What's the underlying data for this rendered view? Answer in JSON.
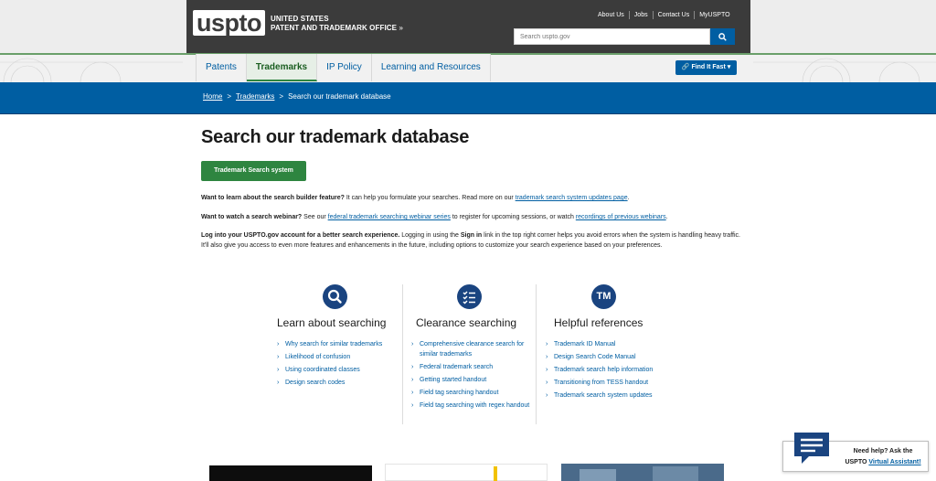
{
  "header": {
    "logo_text": "uspto",
    "office_line1": "UNITED STATES",
    "office_line2": "PATENT AND TRADEMARK OFFICE",
    "office_chevron": "»",
    "util_links": [
      "About Us",
      "Jobs",
      "Contact Us",
      "MyUSPTO"
    ],
    "search_placeholder": "Search uspto.gov"
  },
  "nav": {
    "tabs": [
      {
        "label": "Patents",
        "active": false
      },
      {
        "label": "Trademarks",
        "active": true
      },
      {
        "label": "IP Policy",
        "active": false
      },
      {
        "label": "Learning and Resources",
        "active": false
      }
    ],
    "find_it_fast": "Find It Fast ▾"
  },
  "breadcrumb": {
    "home": "Home",
    "sep": ">",
    "trademarks": "Trademarks",
    "current": "Search our trademark database"
  },
  "main": {
    "title": "Search our trademark database",
    "primary_button": "Trademark Search system",
    "p1_bold": "Want to learn about the search builder feature?",
    "p1_text": " It can help you formulate your searches. Read more on our ",
    "p1_link": "trademark search system updates page",
    "p1_end": ".",
    "p2_bold": "Want to watch a search webinar?",
    "p2_text": " See our ",
    "p2_link1": "federal trademark searching webinar series",
    "p2_mid": " to register for upcoming sessions, or watch ",
    "p2_link2": "recordings of previous webinars",
    "p2_end": ".",
    "p3_bold": "Log into your USPTO.gov account for a better search experience.",
    "p3_text1": " Logging in using the ",
    "p3_bold2": "Sign in",
    "p3_text2": " link in the top right corner helps you avoid errors when the system is handling heavy traffic. It'll also give you access to even more features and enhancements in the future, including options to customize your search experience based on your preferences."
  },
  "columns": [
    {
      "icon": "magnifier-icon",
      "title": "Learn about searching",
      "links": [
        "Why search for similar trademarks",
        "Likelihood of confusion",
        "Using coordinated classes",
        "Design search codes"
      ]
    },
    {
      "icon": "checklist-icon",
      "title": "Clearance searching",
      "links": [
        "Comprehensive clearance search for similar trademarks",
        "Federal trademark search",
        "Getting started handout",
        "Field tag searching handout",
        "Field tag searching with regex handout"
      ]
    },
    {
      "icon": "tm-icon",
      "icon_text": "TM",
      "title": "Helpful references",
      "links": [
        "Trademark ID Manual",
        "Design Search Code Manual",
        "Trademark search help information",
        "Transitioning from TESS handout",
        "Trademark search system updates"
      ]
    }
  ],
  "chat": {
    "line1": "Need help? Ask the",
    "line2_prefix": "USPTO ",
    "line2_link": "Virtual Assistant!"
  },
  "colors": {
    "header_dark": "#3b3b3b",
    "primary_blue": "#005ea2",
    "green_button": "#2e8540",
    "icon_navy": "#1a4480"
  }
}
